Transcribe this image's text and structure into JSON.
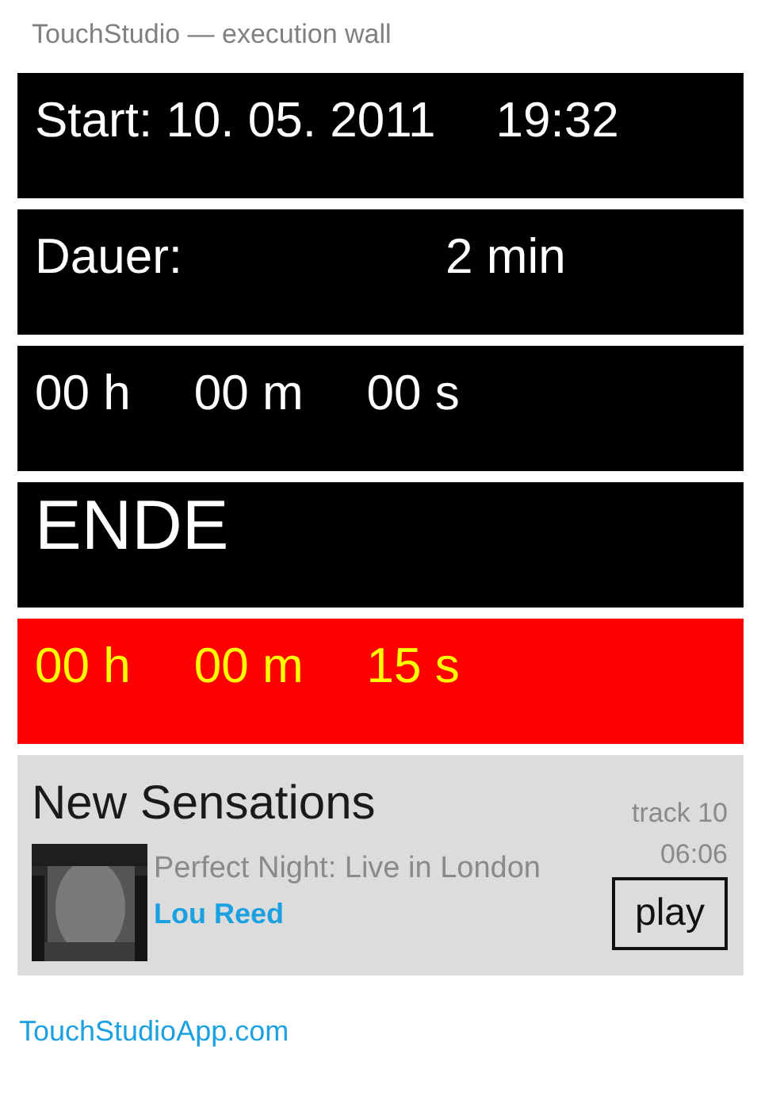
{
  "subtitle": "TouchStudio — execution wall",
  "panels": [
    {
      "kind": "start",
      "texts": [
        "Start: 10. 05. 2011",
        "19:32"
      ]
    },
    {
      "kind": "duration",
      "texts": [
        "Dauer:",
        "2 min"
      ]
    },
    {
      "kind": "clock",
      "texts": [
        "00 h",
        "00 m",
        "00 s"
      ]
    },
    {
      "kind": "heading",
      "texts": [
        "ENDE"
      ]
    },
    {
      "kind": "alert",
      "texts": [
        "00 h",
        "00 m",
        "15 s"
      ]
    }
  ],
  "song": {
    "title": "New Sensations",
    "album": "Perfect Night: Live in London",
    "artist": "Lou Reed",
    "track": "track 10",
    "duration": "06:06",
    "button": "play"
  },
  "link": "TouchStudioApp.com"
}
